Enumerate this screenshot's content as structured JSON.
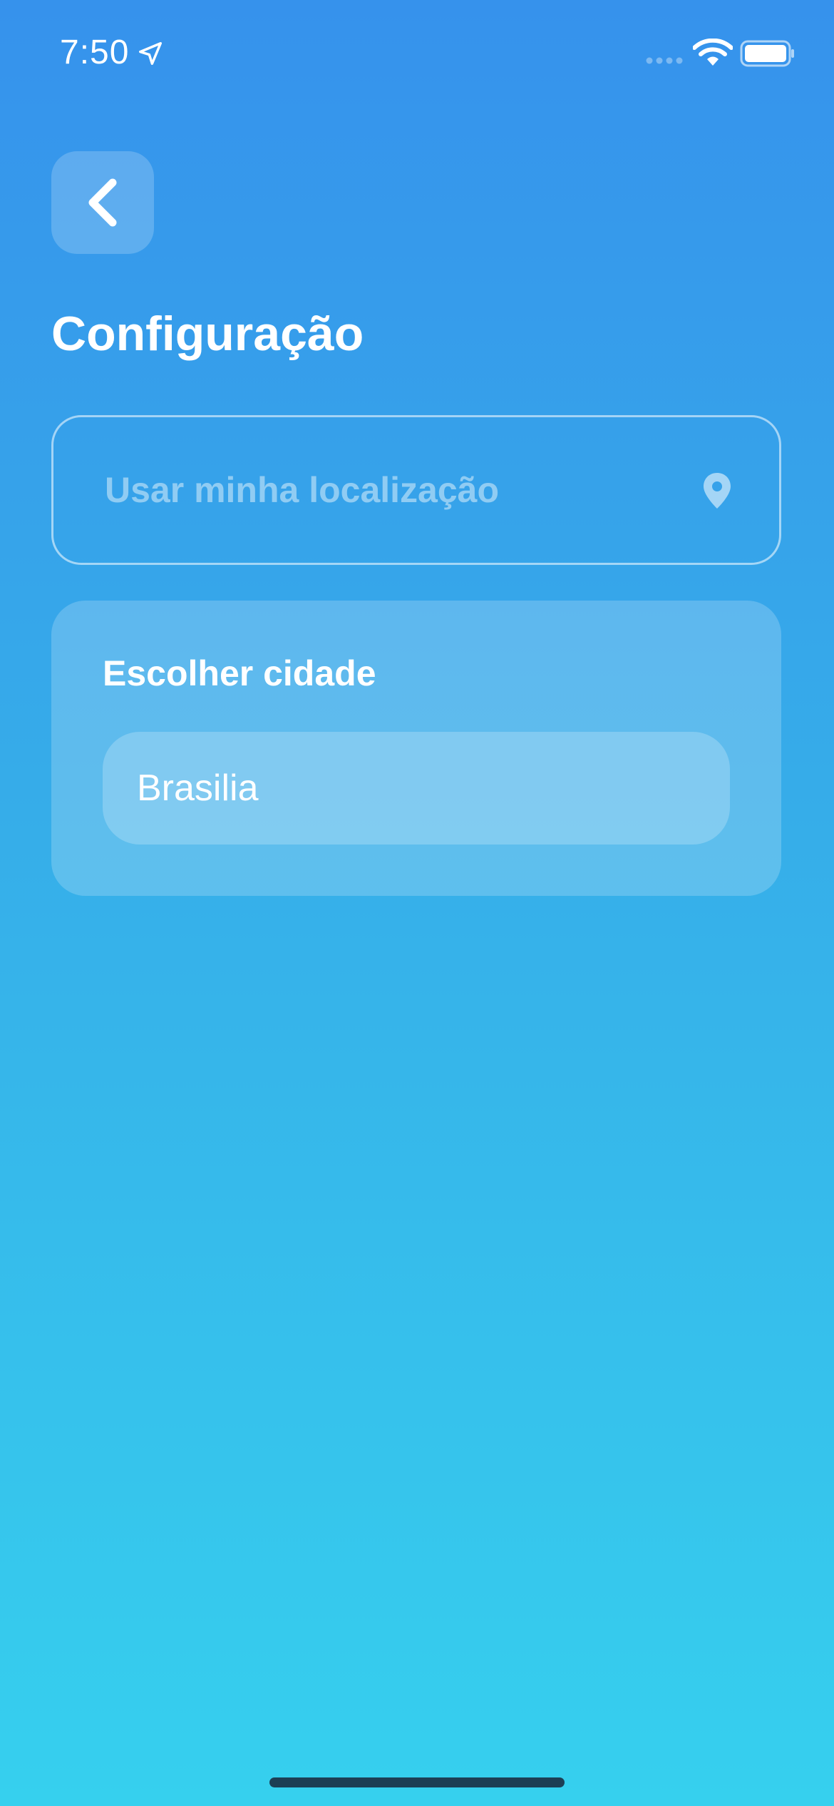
{
  "status_bar": {
    "time": "7:50",
    "icons": [
      "location-arrow-icon",
      "signal-icon",
      "wifi-icon",
      "battery-icon"
    ]
  },
  "header": {
    "back_icon": "chevron-left-icon",
    "title": "Configuração"
  },
  "location_button": {
    "label": "Usar minha localização",
    "icon": "map-pin-icon"
  },
  "city_card": {
    "title": "Escolher cidade",
    "input_value": "Brasilia"
  },
  "colors": {
    "gradient_top": "#3692ec",
    "gradient_mid": "#36ade9",
    "gradient_bottom": "#36d0ee",
    "text": "#ffffff",
    "home_indicator": "#1c3f55"
  }
}
